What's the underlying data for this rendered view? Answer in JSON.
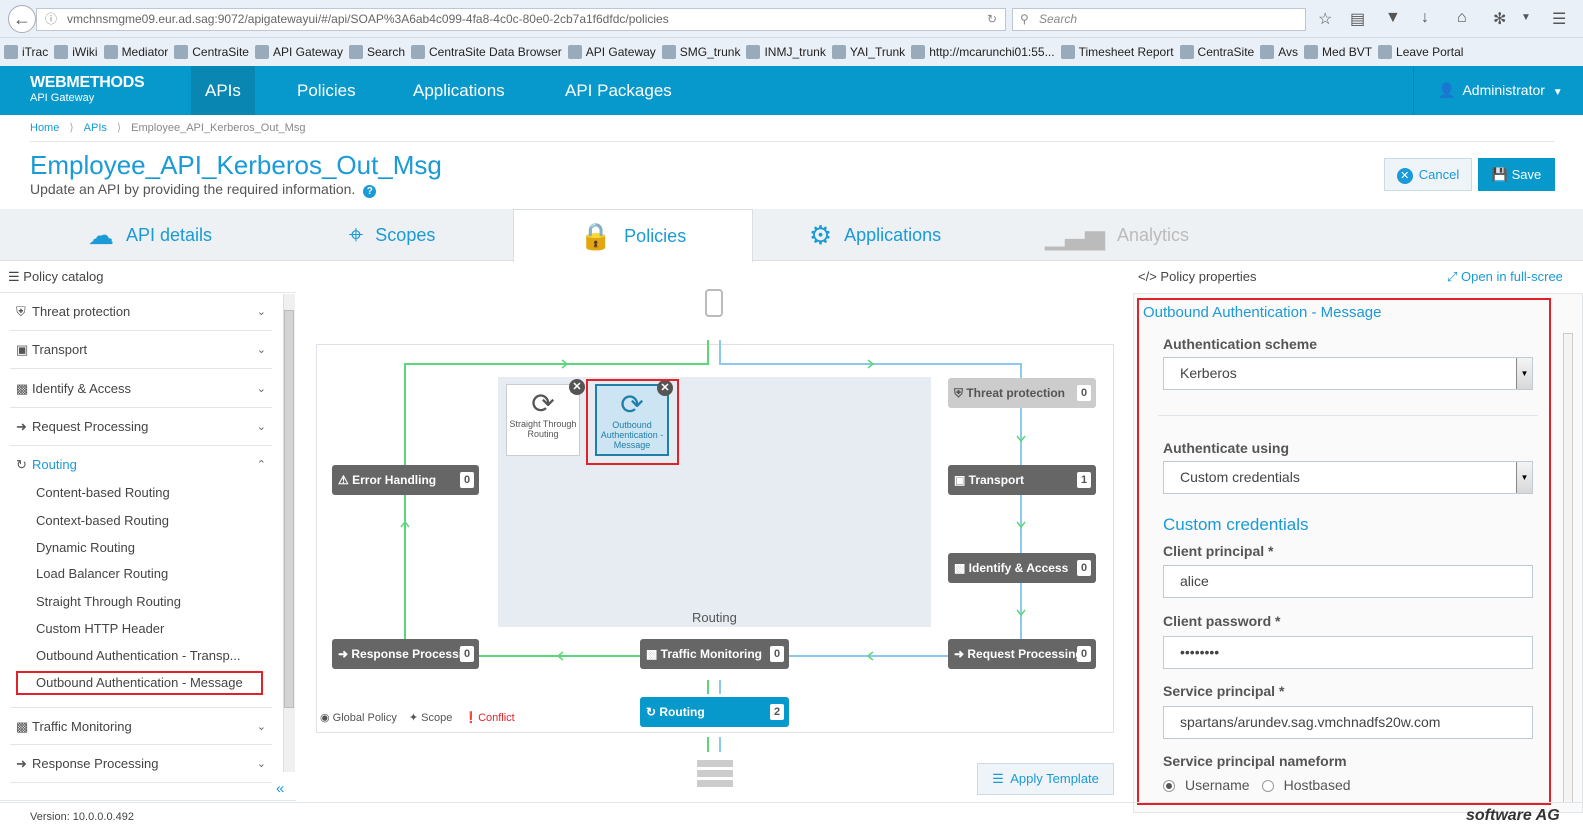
{
  "browser": {
    "url": "vmchnsmgme09.eur.ad.sag:9072/apigatewayui/#/api/SOAP%3A6ab4c099-4fa8-4c0c-80e0-2cb7a1f6dfdc/policies",
    "search_placeholder": "Search",
    "bookmarks": [
      "iTrac",
      "iWiki",
      "Mediator",
      "CentraSite",
      "API Gateway",
      "Search",
      "CentraSite Data Browser",
      "API Gateway",
      "SMG_trunk",
      "INMJ_trunk",
      "YAI_Trunk",
      "http://mcarunchi01:55...",
      "Timesheet Report",
      "CentraSite",
      "Avs",
      "Med BVT",
      "Leave Portal"
    ]
  },
  "header": {
    "logo_title": "WEBMETHODS",
    "logo_subtitle": "API Gateway",
    "nav": [
      "APIs",
      "Policies",
      "Applications",
      "API Packages"
    ],
    "user": "Administrator"
  },
  "breadcrumb": [
    "Home",
    "APIs",
    "Employee_API_Kerberos_Out_Msg"
  ],
  "page": {
    "title": "Employee_API_Kerberos_Out_Msg",
    "subtitle": "Update an API by providing the required information.",
    "cancel": "Cancel",
    "save": "Save"
  },
  "tabs": [
    "API details",
    "Scopes",
    "Policies",
    "Applications",
    "Analytics"
  ],
  "catalog": {
    "header": "Policy catalog",
    "categories": [
      "Threat protection",
      "Transport",
      "Identify & Access",
      "Request Processing",
      "Routing",
      "Traffic Monitoring",
      "Response Processing"
    ],
    "routing_items": [
      "Content-based Routing",
      "Context-based Routing",
      "Dynamic Routing",
      "Load Balancer Routing",
      "Straight Through Routing",
      "Custom HTTP Header",
      "Outbound Authentication - Transp...",
      "Outbound Authentication - Message"
    ]
  },
  "canvas": {
    "routing_label": "Routing",
    "cards": [
      "Straight Through Routing",
      "Outbound Authentication - Message"
    ],
    "stages": [
      {
        "name": "Threat protection",
        "count": "0"
      },
      {
        "name": "Transport",
        "count": "1"
      },
      {
        "name": "Identify & Access",
        "count": "0"
      },
      {
        "name": "Request Processing",
        "count": "0"
      },
      {
        "name": "Traffic Monitoring",
        "count": "0"
      },
      {
        "name": "Routing",
        "count": "2"
      },
      {
        "name": "Response Processi...",
        "count": "0"
      },
      {
        "name": "Error Handling",
        "count": "0"
      }
    ],
    "legend": [
      "Global Policy",
      "Scope",
      "Conflict"
    ],
    "apply_template": "Apply Template"
  },
  "properties": {
    "header": "Policy properties",
    "fullscreen": "Open in full-scree",
    "title": "Outbound Authentication - Message",
    "auth_scheme_label": "Authentication scheme",
    "auth_scheme": "Kerberos",
    "auth_using_label": "Authenticate using",
    "auth_using": "Custom credentials",
    "custom_header": "Custom credentials",
    "client_principal_label": "Client principal *",
    "client_principal": "alice",
    "client_password_label": "Client password *",
    "client_password": "••••••••",
    "service_principal_label": "Service principal *",
    "service_principal": "spartans/arundev.sag.vmchnadfs20w.com",
    "nameform_label": "Service principal nameform",
    "nameform_options": [
      "Username",
      "Hostbased"
    ]
  },
  "footer": {
    "version": "Version: 10.0.0.0.492",
    "brand": "software AG"
  }
}
